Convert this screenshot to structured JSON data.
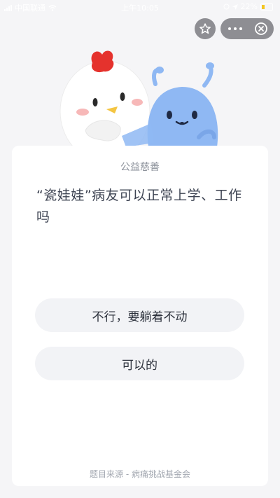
{
  "status_bar": {
    "carrier": "中国联通",
    "time": "上午10:05",
    "battery": "22%"
  },
  "controls": {
    "star_icon": "star-icon",
    "more_icon": "more-dots-icon",
    "close_icon": "close-circle-icon"
  },
  "quiz": {
    "category": "公益慈善",
    "question": "“瓷娃娃”病友可以正常上学、工作吗",
    "options": [
      {
        "label": "不行，要躺着不动"
      },
      {
        "label": "可以的"
      }
    ],
    "source": "题目来源 - 病痛挑战基金会"
  },
  "colors": {
    "background": "#f5f5f7",
    "card": "#ffffff",
    "option_bg": "#f2f3f6",
    "text_primary": "#3d4352",
    "text_secondary": "#8a8f99",
    "mascot_blue": "#8fb8f3",
    "chicken_comb": "#e5322d"
  }
}
